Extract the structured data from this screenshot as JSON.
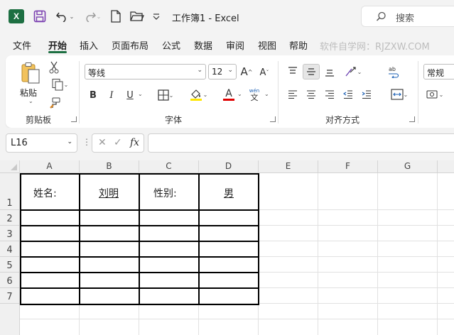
{
  "titlebar": {
    "app_logo": "X",
    "doc_title": "工作簿1  -  Excel",
    "search_placeholder": "搜索",
    "colors": {
      "excel_green": "#1d6f42",
      "save_purple": "#7a3fb0"
    }
  },
  "menu": {
    "tabs": [
      "文件",
      "开始",
      "插入",
      "页面布局",
      "公式",
      "数据",
      "审阅",
      "视图",
      "帮助"
    ],
    "active": "开始",
    "site_tag": "软件自学网：RJZXW.COM"
  },
  "ribbon": {
    "clipboard": {
      "paste_label": "粘贴",
      "group_label": "剪贴板"
    },
    "font": {
      "font_name": "等线",
      "font_size": "12",
      "bold": "B",
      "italic": "I",
      "underline": "U",
      "font_color_glyph": "A",
      "phonetic_glyph": "文",
      "phonetic_top": "wén",
      "group_label": "字体",
      "colors": {
        "highlight": "#ffe600",
        "font_color": "#e00000"
      }
    },
    "alignment": {
      "group_label": "对齐方式"
    },
    "number": {
      "format": "常规"
    }
  },
  "formula_bar": {
    "name_box": "L16",
    "fx_label": "fx",
    "formula": ""
  },
  "sheet": {
    "columns": [
      "A",
      "B",
      "C",
      "D",
      "E",
      "F",
      "G"
    ],
    "rows": [
      "1",
      "2",
      "3",
      "4",
      "5",
      "6",
      "7"
    ],
    "cells": {
      "A1": "姓名:",
      "B1": "刘明",
      "C1": "性别:",
      "D1": "男"
    }
  }
}
